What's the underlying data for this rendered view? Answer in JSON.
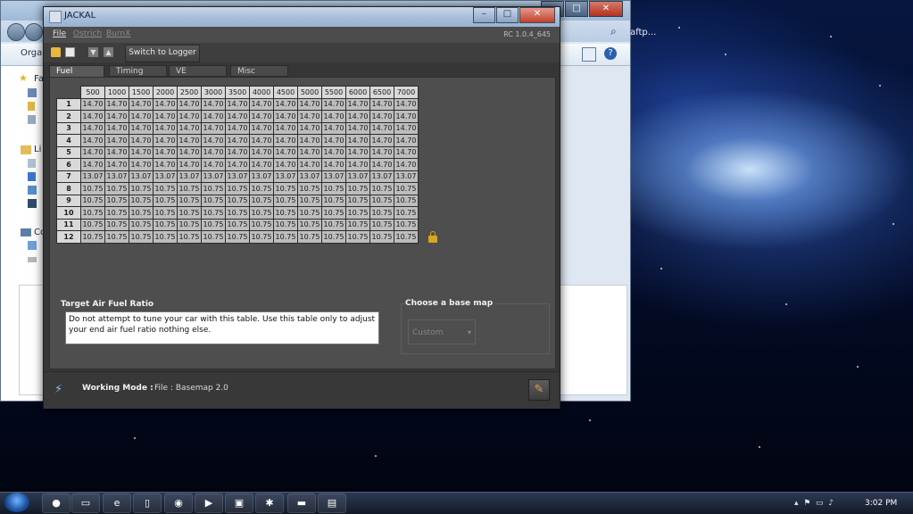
{
  "explorer": {
    "organize_label": "Organ",
    "peek_text": "aftp...",
    "tree": [
      "Fa",
      "Li",
      "Co"
    ]
  },
  "window": {
    "title": "JACKAL",
    "version": "RC 1.0.4_645",
    "min": "–",
    "max": "□",
    "close": "✕"
  },
  "menu": {
    "file": "File",
    "ostrich": "Ostrich",
    "burnx": "BurnX"
  },
  "toolbar": {
    "switch_label": "Switch to Logger"
  },
  "tabs": [
    "Fuel",
    "Timing",
    "VE",
    "Misc"
  ],
  "fuel_table": {
    "columns": [
      "500",
      "1000",
      "1500",
      "2000",
      "2500",
      "3000",
      "3500",
      "4000",
      "4500",
      "5000",
      "5500",
      "6000",
      "6500",
      "7000"
    ],
    "rows": [
      {
        "label": "1",
        "values": [
          "14.70",
          "14.70",
          "14.70",
          "14.70",
          "14.70",
          "14.70",
          "14.70",
          "14.70",
          "14.70",
          "14.70",
          "14.70",
          "14.70",
          "14.70",
          "14.70"
        ]
      },
      {
        "label": "2",
        "values": [
          "14.70",
          "14.70",
          "14.70",
          "14.70",
          "14.70",
          "14.70",
          "14.70",
          "14.70",
          "14.70",
          "14.70",
          "14.70",
          "14.70",
          "14.70",
          "14.70"
        ]
      },
      {
        "label": "3",
        "values": [
          "14.70",
          "14.70",
          "14.70",
          "14.70",
          "14.70",
          "14.70",
          "14.70",
          "14.70",
          "14.70",
          "14.70",
          "14.70",
          "14.70",
          "14.70",
          "14.70"
        ]
      },
      {
        "label": "4",
        "values": [
          "14.70",
          "14.70",
          "14.70",
          "14.70",
          "14.70",
          "14.70",
          "14.70",
          "14.70",
          "14.70",
          "14.70",
          "14.70",
          "14.70",
          "14.70",
          "14.70"
        ]
      },
      {
        "label": "5",
        "values": [
          "14.70",
          "14.70",
          "14.70",
          "14.70",
          "14.70",
          "14.70",
          "14.70",
          "14.70",
          "14.70",
          "14.70",
          "14.70",
          "14.70",
          "14.70",
          "14.70"
        ]
      },
      {
        "label": "6",
        "values": [
          "14.70",
          "14.70",
          "14.70",
          "14.70",
          "14.70",
          "14.70",
          "14.70",
          "14.70",
          "14.70",
          "14.70",
          "14.70",
          "14.70",
          "14.70",
          "14.70"
        ]
      },
      {
        "label": "7",
        "values": [
          "13.07",
          "13.07",
          "13.07",
          "13.07",
          "13.07",
          "13.07",
          "13.07",
          "13.07",
          "13.07",
          "13.07",
          "13.07",
          "13.07",
          "13.07",
          "13.07"
        ]
      },
      {
        "label": "8",
        "values": [
          "10.75",
          "10.75",
          "10.75",
          "10.75",
          "10.75",
          "10.75",
          "10.75",
          "10.75",
          "10.75",
          "10.75",
          "10.75",
          "10.75",
          "10.75",
          "10.75"
        ]
      },
      {
        "label": "9",
        "values": [
          "10.75",
          "10.75",
          "10.75",
          "10.75",
          "10.75",
          "10.75",
          "10.75",
          "10.75",
          "10.75",
          "10.75",
          "10.75",
          "10.75",
          "10.75",
          "10.75"
        ]
      },
      {
        "label": "10",
        "values": [
          "10.75",
          "10.75",
          "10.75",
          "10.75",
          "10.75",
          "10.75",
          "10.75",
          "10.75",
          "10.75",
          "10.75",
          "10.75",
          "10.75",
          "10.75",
          "10.75"
        ]
      },
      {
        "label": "11",
        "values": [
          "10.75",
          "10.75",
          "10.75",
          "10.75",
          "10.75",
          "10.75",
          "10.75",
          "10.75",
          "10.75",
          "10.75",
          "10.75",
          "10.75",
          "10.75",
          "10.75"
        ]
      },
      {
        "label": "12",
        "values": [
          "10.75",
          "10.75",
          "10.75",
          "10.75",
          "10.75",
          "10.75",
          "10.75",
          "10.75",
          "10.75",
          "10.75",
          "10.75",
          "10.75",
          "10.75",
          "10.75"
        ]
      }
    ]
  },
  "target_afr": {
    "label": "Target Air Fuel Ratio",
    "text": "Do not attempt to tune your car with this table. Use this table only to adjust your end air fuel ratio nothing else."
  },
  "base_map": {
    "label": "Choose a base map",
    "selected": "Custom"
  },
  "status": {
    "mode_label": "Working Mode :",
    "mode_value": "File : Basemap 2.0"
  },
  "taskbar": {
    "clock": "3:02 PM"
  },
  "icons": {
    "open": "folder-icon",
    "save": "save-icon",
    "download": "download-icon",
    "upload": "upload-icon",
    "lock": "lock-icon",
    "connection": "connection-icon",
    "edit": "pencil-icon"
  },
  "colors": {
    "window_bg": "#363636",
    "panel_bg": "#4e4e4e",
    "cell_bg": "#bdbdbd",
    "header_bg": "#d9d9d9"
  }
}
